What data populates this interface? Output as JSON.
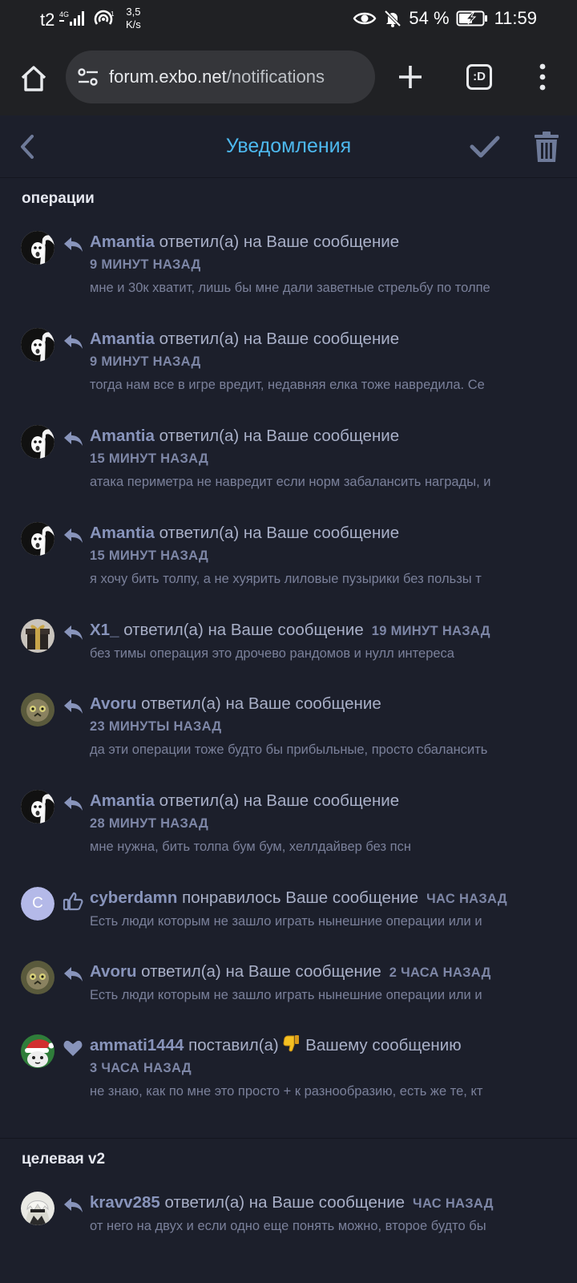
{
  "status_bar": {
    "carrier": "t2",
    "network_type": "4G",
    "speed": "3,5",
    "speed_unit": "K/s",
    "battery": "54 %",
    "time": "11:59",
    "icons": [
      "signal-icon",
      "hotspot-icon",
      "eye-icon",
      "bell-off-icon",
      "battery-charging-icon"
    ]
  },
  "browser": {
    "url_host": "forum.exbo.net",
    "url_path": "/notifications",
    "tab_label": ":D"
  },
  "header": {
    "title": "Уведомления"
  },
  "colors": {
    "background": "#1c1f2b",
    "accent": "#4db8ee",
    "username": "#8894bb",
    "text": "#a9b0c8",
    "muted": "#7d86a6"
  },
  "groups": [
    {
      "title": "операции",
      "items": [
        {
          "user": "Amantia",
          "action": "ответил(а) на Ваше сообщение",
          "time": "9 МИНУТ НАЗАД",
          "inline_time": false,
          "type_icon": "reply-icon",
          "avatar": "amantia",
          "excerpt": "мне и 30к хватит, лишь бы мне дали заветные стрельбу по толпе"
        },
        {
          "user": "Amantia",
          "action": "ответил(а) на Ваше сообщение",
          "time": "9 МИНУТ НАЗАД",
          "inline_time": false,
          "type_icon": "reply-icon",
          "avatar": "amantia",
          "excerpt": "тогда нам все в игре вредит, недавняя елка тоже навредила. Се"
        },
        {
          "user": "Amantia",
          "action": "ответил(а) на Ваше сообщение",
          "time": "15 МИНУТ НАЗАД",
          "inline_time": false,
          "type_icon": "reply-icon",
          "avatar": "amantia",
          "excerpt": "атака периметра не навредит если норм забалансить награды, и"
        },
        {
          "user": "Amantia",
          "action": "ответил(а) на Ваше сообщение",
          "time": "15 МИНУТ НАЗАД",
          "inline_time": false,
          "type_icon": "reply-icon",
          "avatar": "amantia",
          "excerpt": "я хочу бить толпу, а не хуярить лиловые пузырики без пользы т"
        },
        {
          "user": "X1_",
          "action": "ответил(а) на Ваше сообщение",
          "time": "19 МИНУТ НАЗАД",
          "inline_time": true,
          "type_icon": "reply-icon",
          "avatar": "gift",
          "excerpt": "без тимы операция это дрочево рандомов и нулл интереса"
        },
        {
          "user": "Avoru",
          "action": "ответил(а) на Ваше сообщение",
          "time": "23 МИНУТЫ НАЗАД",
          "inline_time": false,
          "type_icon": "reply-icon",
          "avatar": "avoru",
          "excerpt": "да эти операции тоже будто бы прибыльные, просто сбалансить"
        },
        {
          "user": "Amantia",
          "action": "ответил(а) на Ваше сообщение",
          "time": "28 МИНУТ НАЗАД",
          "inline_time": false,
          "type_icon": "reply-icon",
          "avatar": "amantia",
          "excerpt": "мне нужна, бить толпа бум бум, хеллдайвер без псн"
        },
        {
          "user": "cyberdamn",
          "action": "понравилось Ваше сообщение",
          "time": "ЧАС НАЗАД",
          "inline_time": true,
          "type_icon": "thumbs-up-icon",
          "avatar": "letter",
          "avatar_letter": "C",
          "excerpt": "Есть люди которым не зашло играть нынешние операции или и"
        },
        {
          "user": "Avoru",
          "action": "ответил(а) на Ваше сообщение",
          "time": "2 ЧАСА НАЗАД",
          "inline_time": true,
          "type_icon": "reply-icon",
          "avatar": "avoru",
          "excerpt": "Есть люди которым не зашло играть нынешние операции или и"
        },
        {
          "user": "ammati1444",
          "action": "поставил(а)",
          "action_emoji": "thumbs-down-emoji",
          "action_suffix": "Вашему сообщению",
          "time": "3 ЧАСА НАЗАД",
          "inline_time": false,
          "type_icon": "heart-icon",
          "avatar": "santa",
          "excerpt": "не знаю, как по мне это просто + к разнообразию, есть же те, кт"
        }
      ]
    },
    {
      "title": "целевая v2",
      "items": [
        {
          "user": "kravv285",
          "action": "ответил(а) на Ваше сообщение",
          "time": "ЧАС НАЗАД",
          "inline_time": true,
          "type_icon": "reply-icon",
          "avatar": "kravv",
          "excerpt": "от него на двух и если одно еще понять можно, второе будто бы"
        }
      ]
    }
  ]
}
